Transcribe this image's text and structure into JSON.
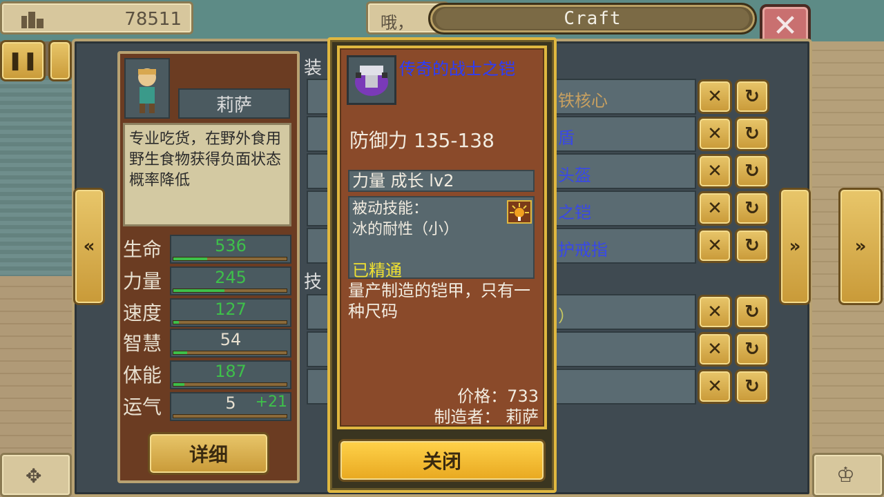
{
  "topbar": {
    "coins": "78511",
    "message": "哦，",
    "title": "Craft",
    "close": "✕"
  },
  "icons": {
    "coins": "building-icon",
    "pause": "pause-icon",
    "dpad": "dpad-icon",
    "crown": "crown-icon",
    "left": "double-left-arrow-icon",
    "right": "double-right-arrow-icon"
  },
  "character": {
    "name": "莉萨",
    "description": "专业吃货，在野外食用野生食物获得负面状态概率降低",
    "stats": [
      {
        "label": "生命",
        "value": "536",
        "color": "#3ec04a",
        "fill": 0.3
      },
      {
        "label": "力量",
        "value": "245",
        "color": "#3ec04a",
        "fill": 0.45
      },
      {
        "label": "速度",
        "value": "127",
        "color": "#3ec04a",
        "fill": 0.05
      },
      {
        "label": "智慧",
        "value": "54",
        "color": "#e8e0d0",
        "fill": 0.12
      },
      {
        "label": "体能",
        "value": "187",
        "color": "#3ec04a",
        "fill": 0.1
      },
      {
        "label": "运气",
        "value": "5",
        "color": "#e8e0d0",
        "fill": 0.0,
        "bonus": "+21"
      }
    ],
    "detail_button": "详细"
  },
  "equipment": {
    "heading": "装",
    "skill_heading": "技",
    "rows": [
      {
        "name": "铁核心",
        "color": "#c8a060"
      },
      {
        "name": "盾",
        "color": "#3848e8"
      },
      {
        "name": "头盔",
        "color": "#3848e8"
      },
      {
        "name": "之铠",
        "color": "#3848e8"
      },
      {
        "name": "护戒指",
        "color": "#3848e8"
      },
      {
        "name": "）",
        "color": "#c8c860"
      },
      {
        "name": "",
        "color": "#ddd"
      },
      {
        "name": "",
        "color": "#ddd"
      }
    ]
  },
  "item": {
    "name": "传奇的战士之铠",
    "defense": "防御力 135-138",
    "growth": "力量 成长 lv2",
    "skill_title": "被动技能：",
    "skill_name": "冰的耐性（小）",
    "mastered": "已精通",
    "flavor": "量产制造的铠甲，只有一种尺码",
    "price": "价格：733",
    "maker": "制造者： 莉萨",
    "close_button": "关闭"
  },
  "colors": {
    "item_name": "#2a3cff",
    "mastered": "#f0e030",
    "stat_green": "#3ec04a"
  }
}
